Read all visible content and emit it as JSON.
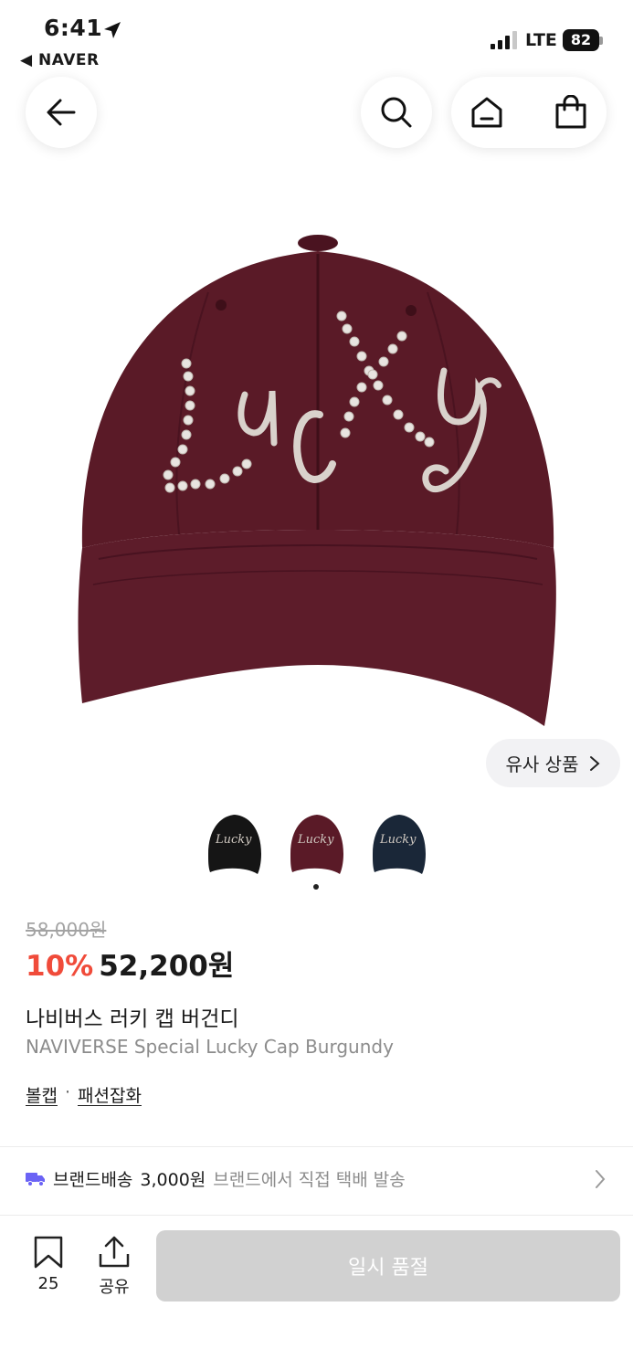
{
  "status_bar": {
    "time": "6:41",
    "back_app": "◀ NAVER",
    "network": "LTE",
    "battery": "82"
  },
  "nav": {
    "back_icon": "arrow-left-icon",
    "search_icon": "search-icon",
    "home_icon": "home-icon",
    "cart_icon": "shopping-bag-icon"
  },
  "product_image": {
    "cap_color": "#5a1a27",
    "embroidery_text": "LUCKY",
    "embroidery_color": "#d9d2cc"
  },
  "similar_button": {
    "label": "유사 상품"
  },
  "thumbnails": [
    {
      "color": "#151515",
      "text": "Lucky"
    },
    {
      "color": "#5a1a27",
      "text": "Lucky"
    },
    {
      "color": "#1a2738",
      "text": "Lucky"
    }
  ],
  "price": {
    "original": "58,000원",
    "discount": "10%",
    "current": "52,200원"
  },
  "title_kr": "나비버스 러키 캡 버건디",
  "title_en": "NAVIVERSE Special Lucky Cap Burgundy",
  "categories": {
    "first": "볼캡",
    "separator": "·",
    "second": "패션잡화"
  },
  "shipping": {
    "label": "브랜드배송",
    "fee": "3,000원",
    "desc": "브랜드에서 직접 택배 발송",
    "icon": "truck-icon"
  },
  "bottom": {
    "bookmark_count": "25",
    "share_label": "공유",
    "soldout_label": "일시 품절"
  },
  "colors": {
    "accent_red": "#f04b3a",
    "truck_purple": "#6b63f5",
    "disabled_button": "#d1d1d1"
  }
}
